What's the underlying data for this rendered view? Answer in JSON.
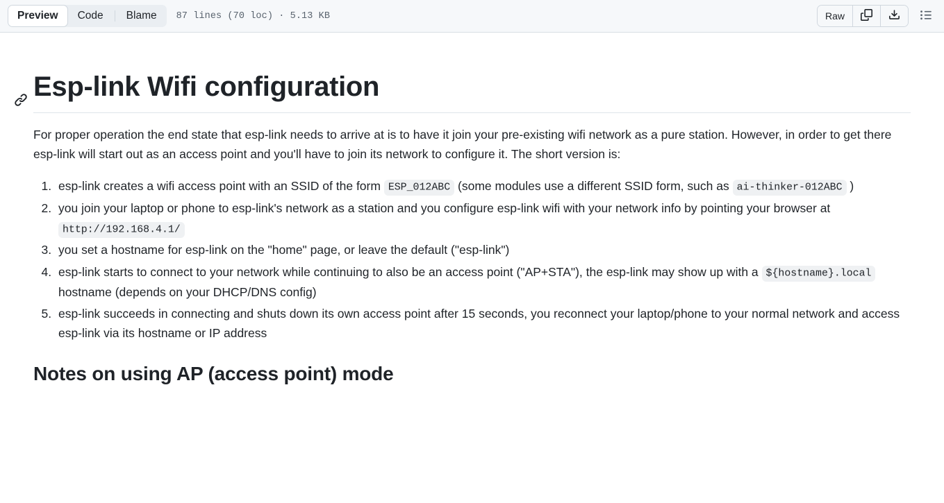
{
  "header": {
    "tabs": [
      {
        "label": "Preview",
        "active": true
      },
      {
        "label": "Code",
        "active": false
      },
      {
        "label": "Blame",
        "active": false
      }
    ],
    "file_meta": "87 lines (70 loc) · 5.13 KB",
    "raw_label": "Raw",
    "icons": {
      "copy": "copy-icon",
      "download": "download-icon",
      "outline": "outline-list-icon"
    }
  },
  "document": {
    "title": "Esp-link Wifi configuration",
    "intro": "For proper operation the end state that esp-link needs to arrive at is to have it join your pre-existing wifi network as a pure station. However, in order to get there esp-link will start out as an access point and you'll have to join its network to configure it. The short version is:",
    "steps": [
      {
        "parts": [
          {
            "type": "text",
            "value": "esp-link creates a wifi access point with an SSID of the form "
          },
          {
            "type": "code",
            "value": "ESP_012ABC"
          },
          {
            "type": "text",
            "value": " (some modules use a different SSID form, such as "
          },
          {
            "type": "code",
            "value": "ai-thinker-012ABC"
          },
          {
            "type": "text",
            "value": " )"
          }
        ]
      },
      {
        "parts": [
          {
            "type": "text",
            "value": "you join your laptop or phone to esp-link's network as a station and you configure esp-link wifi with your network info by pointing your browser at "
          },
          {
            "type": "code",
            "value": "http://192.168.4.1/"
          }
        ]
      },
      {
        "parts": [
          {
            "type": "text",
            "value": "you set a hostname for esp-link on the \"home\" page, or leave the default (\"esp-link\")"
          }
        ]
      },
      {
        "parts": [
          {
            "type": "text",
            "value": "esp-link starts to connect to your network while continuing to also be an access point (\"AP+STA\"), the esp-link may show up with a "
          },
          {
            "type": "code",
            "value": "${hostname}.local"
          },
          {
            "type": "text",
            "value": " hostname (depends on your DHCP/DNS config)"
          }
        ]
      },
      {
        "parts": [
          {
            "type": "text",
            "value": "esp-link succeeds in connecting and shuts down its own access point after 15 seconds, you reconnect your laptop/phone to your normal network and access esp-link via its hostname or IP address"
          }
        ]
      }
    ],
    "section_heading": "Notes on using AP (access point) mode"
  },
  "colors": {
    "header_bg": "#f6f8fa",
    "border": "#d0d7de",
    "text": "#1f2328",
    "muted": "#59636e",
    "code_bg": "#eff1f3"
  }
}
